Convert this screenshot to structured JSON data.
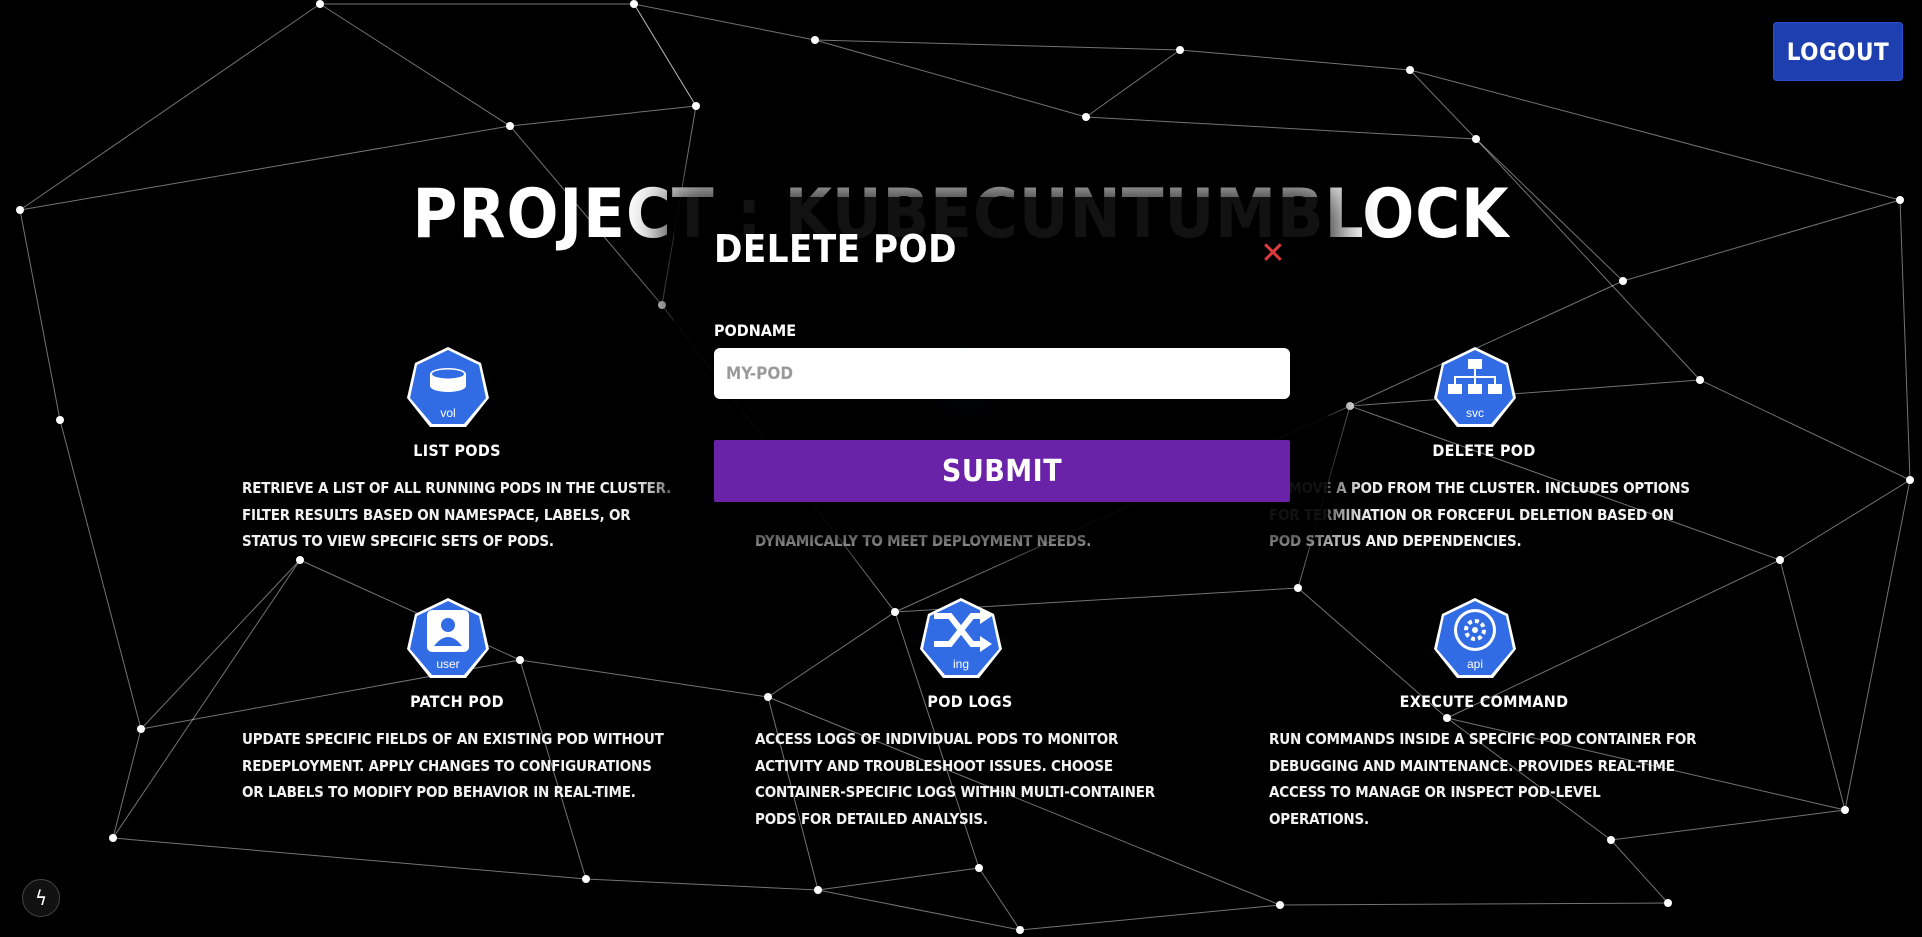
{
  "header": {
    "logout_label": "LOGOUT",
    "title": "PROJECT : KUBECUNTUMBLOCK"
  },
  "colors": {
    "background": "#000000",
    "accent_blue": "#1e3fb0",
    "icon_blue": "#326ce5",
    "submit_purple": "#6a22a8",
    "close_red": "#e23b3b"
  },
  "cards": [
    {
      "icon": "volume-icon",
      "badge": "vol",
      "title": "LIST PODS",
      "desc": "Retrieve a list of all running pods in the cluster. Filter results based on namespace, labels, or status to view specific sets of pods."
    },
    {
      "icon": "service-icon",
      "badge": "svc",
      "title": "DELETE POD",
      "desc": "Remove a pod from the cluster. Includes options for termination or forceful deletion based on pod status and dependencies."
    },
    {
      "icon": "user-icon",
      "badge": "user",
      "title": "PATCH POD",
      "desc": "Update specific fields of an existing pod without redeployment. Apply changes to configurations or labels to modify pod behavior in real-time."
    },
    {
      "icon": "ingress-icon",
      "badge": "ing",
      "title": "POD LOGS",
      "desc": "Access logs of individual pods to monitor activity and troubleshoot issues. Choose container-specific logs within multi-container pods for detailed analysis."
    },
    {
      "icon": "api-icon",
      "badge": "api",
      "title": "EXECUTE COMMAND",
      "desc": "Run commands inside a specific pod container for debugging and maintenance. Provides real-time access to manage or inspect pod-level operations."
    }
  ],
  "hidden_card_desc_tail": "dynamically to meet deployment needs.",
  "modal": {
    "title": "DELETE POD",
    "field_label": "PODNAME",
    "input_placeholder": "MY-POD",
    "input_value": "",
    "submit_label": "SUBMIT",
    "close_symbol": "✕"
  },
  "footer": {
    "bolt_symbol": "ϟ"
  }
}
